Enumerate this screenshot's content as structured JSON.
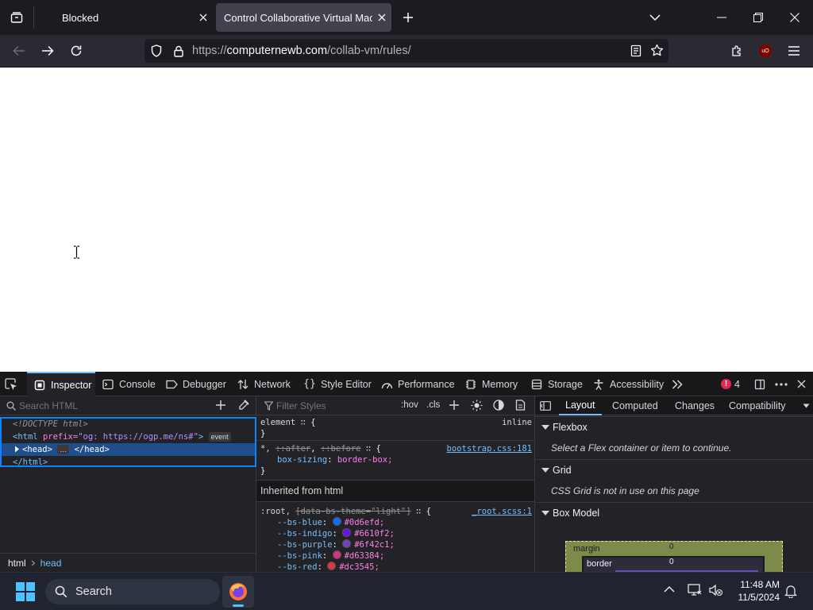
{
  "browser": {
    "tabs": [
      {
        "title": "Blocked"
      },
      {
        "title": "Control Collaborative Virtual Machine"
      }
    ],
    "url": {
      "scheme": "https://",
      "host": "computernewb.com",
      "path": "/collab-vm/rules/"
    },
    "ublock_badge": "uO"
  },
  "devtools": {
    "tabs": [
      "Inspector",
      "Console",
      "Debugger",
      "Network",
      "Style Editor",
      "Performance",
      "Memory",
      "Storage",
      "Accessibility"
    ],
    "error_count": "4",
    "search_placeholder": "Search HTML",
    "markup": {
      "doctype": "<!DOCTYPE html>",
      "html_open_tag": "<html",
      "html_attr": "prefix=",
      "html_attr_val": "\"og: https://ogp.me/ns#\"",
      "html_close_bracket": ">",
      "event_badge": "event",
      "head_open": "<head>",
      "head_close": "</head>",
      "ellipsis_badge": "…",
      "html_close": "</html>"
    },
    "breadcrumb": [
      "html",
      "head"
    ],
    "rules": {
      "filter_placeholder": "Filter Styles",
      "hov": ":hov",
      "cls": ".cls",
      "element_selector": "element",
      "element_source": "inline",
      "universal_selector": "*,",
      "after": "::after",
      "before": "::before",
      "universal_source": "bootstrap.css:181",
      "box_sizing_prop": "box-sizing",
      "box_sizing_val": "border-box;",
      "inherited_label": "Inherited from html",
      "root_selector": ":root,",
      "root_attr": "[data-bs-theme=\"light\"]",
      "root_source": "_root.scss:1",
      "vars": [
        {
          "name": "--bs-blue",
          "value": "#0d6efd;",
          "color": "#0d6efd"
        },
        {
          "name": "--bs-indigo",
          "value": "#6610f2;",
          "color": "#6610f2"
        },
        {
          "name": "--bs-purple",
          "value": "#6f42c1;",
          "color": "#6f42c1"
        },
        {
          "name": "--bs-pink",
          "value": "#d63384;",
          "color": "#d63384"
        },
        {
          "name": "--bs-red",
          "value": "#dc3545;",
          "color": "#dc3545"
        }
      ]
    },
    "layout": {
      "tabs": [
        "Layout",
        "Computed",
        "Changes",
        "Compatibility"
      ],
      "flexbox_title": "Flexbox",
      "flexbox_hint": "Select a Flex container or item to continue.",
      "grid_title": "Grid",
      "grid_hint": "CSS Grid is not in use on this page",
      "boxmodel_title": "Box Model",
      "margin_label": "margin",
      "margin_value": "0",
      "border_label": "border",
      "border_value": "0"
    }
  },
  "taskbar": {
    "search_label": "Search",
    "time": "11:48 AM",
    "date": "11/5/2024"
  }
}
